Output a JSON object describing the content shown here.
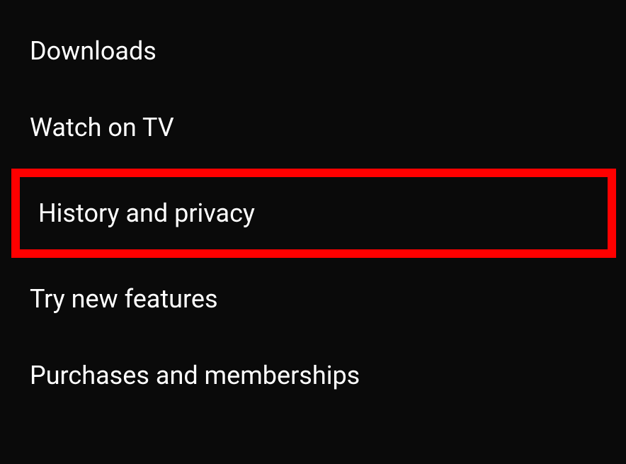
{
  "settings": {
    "items": [
      {
        "label": "Downloads"
      },
      {
        "label": "Watch on TV"
      },
      {
        "label": "History and privacy"
      },
      {
        "label": "Try new features"
      },
      {
        "label": "Purchases and memberships"
      }
    ]
  }
}
